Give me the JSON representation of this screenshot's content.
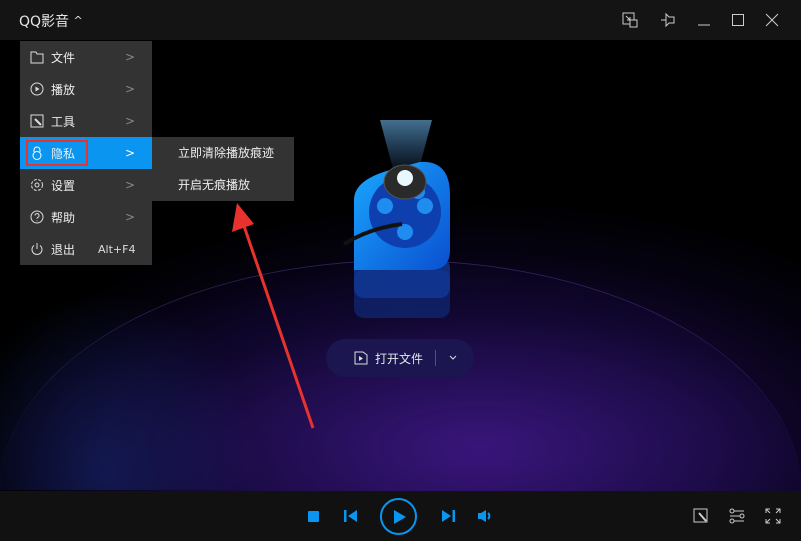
{
  "title_bar": {
    "app_name": "QQ影音",
    "caret": "^"
  },
  "menu": {
    "items": [
      {
        "label": "文件",
        "icon": "folder-icon",
        "has_submenu": true
      },
      {
        "label": "播放",
        "icon": "play-circle-icon",
        "has_submenu": true
      },
      {
        "label": "工具",
        "icon": "tools-icon",
        "has_submenu": true
      },
      {
        "label": "隐私",
        "icon": "lock-icon",
        "has_submenu": true,
        "active": true
      },
      {
        "label": "设置",
        "icon": "gear-icon",
        "has_submenu": true
      },
      {
        "label": "帮助",
        "icon": "help-icon",
        "has_submenu": true
      },
      {
        "label": "退出",
        "icon": "power-icon",
        "shortcut": "Alt+F4"
      }
    ],
    "arrow": ">"
  },
  "submenu": {
    "items": [
      "立即清除播放痕迹",
      "开启无痕播放"
    ]
  },
  "open_file": {
    "label": "打开文件"
  },
  "colors": {
    "accent": "#0a96f0",
    "highlight": "#e8322e"
  }
}
